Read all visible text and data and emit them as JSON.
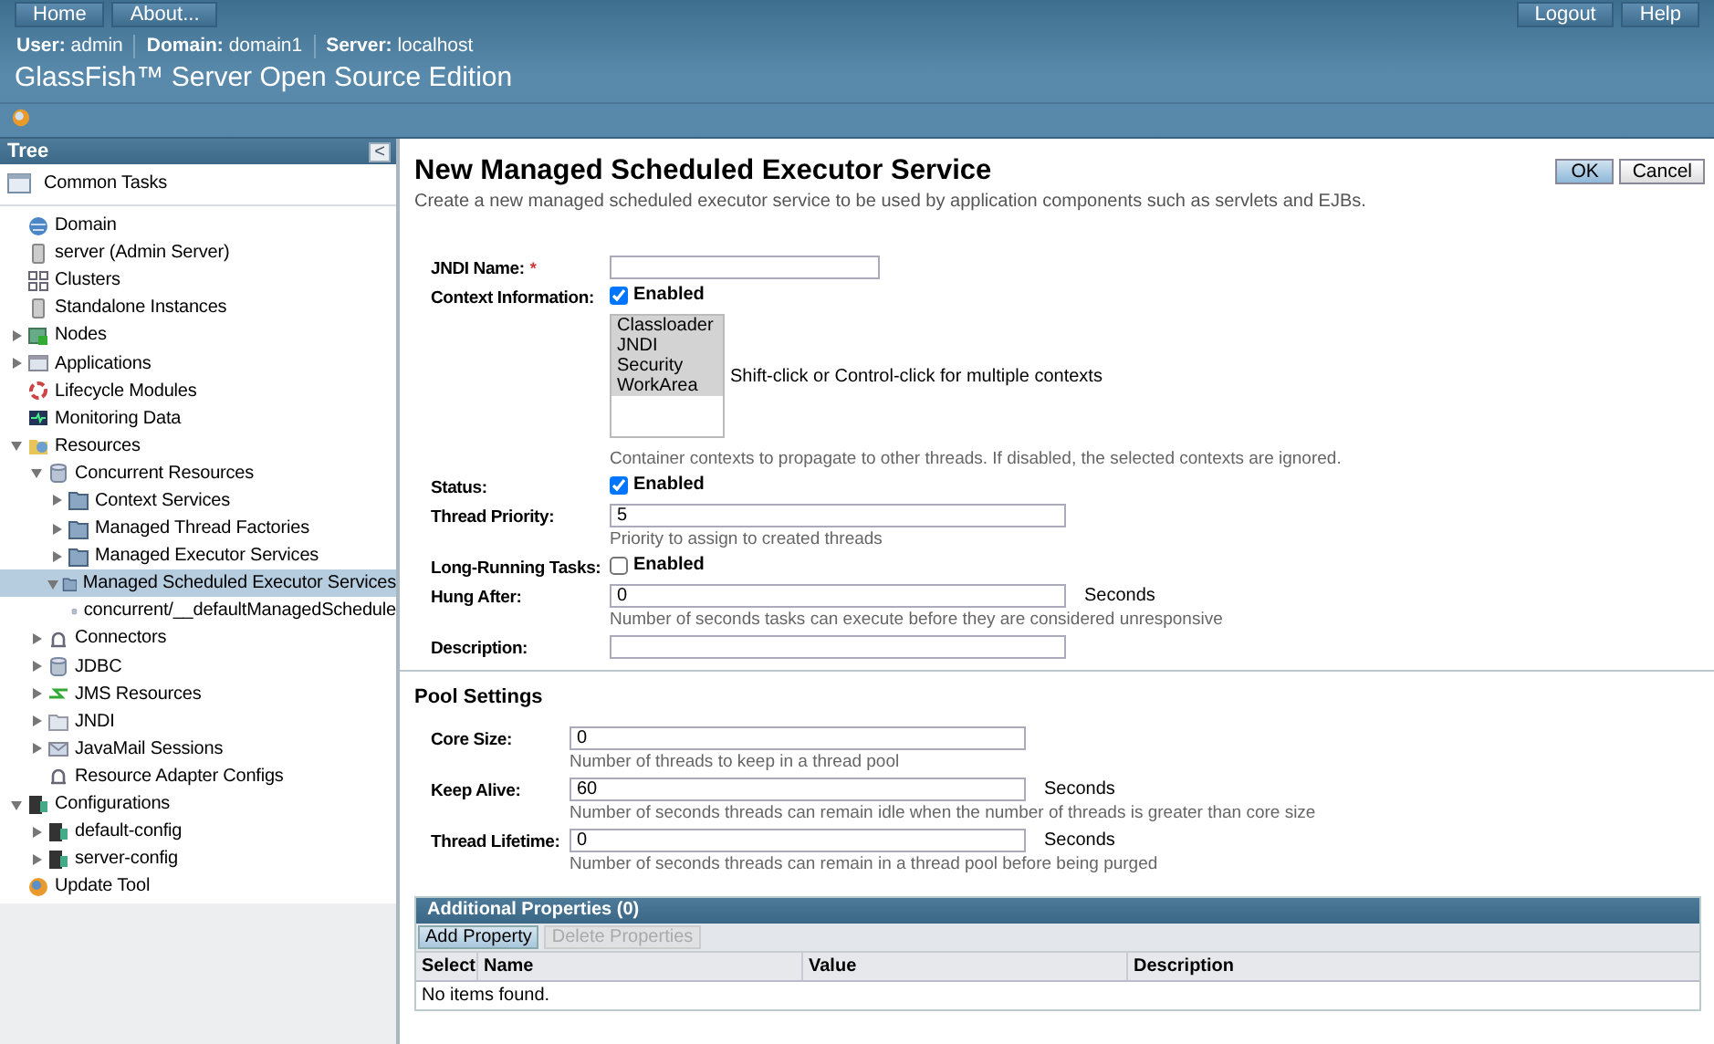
{
  "masthead": {
    "nav": [
      "Home",
      "About..."
    ],
    "session": [
      {
        "label": "User:",
        "value": "admin"
      },
      {
        "label": "Domain:",
        "value": "domain1"
      },
      {
        "label": "Server:",
        "value": "localhost"
      }
    ],
    "actions": [
      "Logout",
      "Help"
    ],
    "product": "GlassFish™ Server Open Source Edition"
  },
  "tree": {
    "title": "Tree",
    "collapse": "<",
    "common_tasks": "Common Tasks",
    "items": [
      {
        "label": "Domain",
        "selected": false
      },
      {
        "label": "server (Admin Server)",
        "selected": false
      },
      {
        "label": "Clusters",
        "selected": false
      },
      {
        "label": "Standalone Instances",
        "selected": false
      },
      {
        "label": "Nodes",
        "selected": false,
        "expanded": false
      },
      {
        "label": "Applications",
        "selected": false,
        "expanded": false
      },
      {
        "label": "Lifecycle Modules",
        "selected": false
      },
      {
        "label": "Monitoring Data",
        "selected": false
      },
      {
        "label": "Resources",
        "selected": false,
        "expanded": true,
        "children": [
          {
            "label": "Concurrent Resources",
            "selected": false,
            "expanded": true,
            "children": [
              {
                "label": "Context Services",
                "selected": false,
                "expanded": false
              },
              {
                "label": "Managed Thread Factories",
                "selected": false,
                "expanded": false
              },
              {
                "label": "Managed Executor Services",
                "selected": false,
                "expanded": false
              },
              {
                "label": "Managed Scheduled Executor Services",
                "selected": true,
                "expanded": true,
                "children": [
                  {
                    "label": "concurrent/__defaultManagedSchedule",
                    "selected": false
                  }
                ]
              }
            ]
          },
          {
            "label": "Connectors",
            "selected": false,
            "expanded": false
          },
          {
            "label": "JDBC",
            "selected": false,
            "expanded": false
          },
          {
            "label": "JMS Resources",
            "selected": false,
            "expanded": false
          },
          {
            "label": "JNDI",
            "selected": false,
            "expanded": false
          },
          {
            "label": "JavaMail Sessions",
            "selected": false,
            "expanded": false
          },
          {
            "label": "Resource Adapter Configs",
            "selected": false
          }
        ]
      },
      {
        "label": "Configurations",
        "selected": false,
        "expanded": true,
        "children": [
          {
            "label": "default-config",
            "selected": false,
            "expanded": false
          },
          {
            "label": "server-config",
            "selected": false,
            "expanded": false
          }
        ]
      },
      {
        "label": "Update Tool",
        "selected": false
      }
    ]
  },
  "page": {
    "title": "New Managed Scheduled Executor Service",
    "description": "Create a new managed scheduled executor service to be used by application components such as servlets and EJBs.",
    "buttons": [
      "OK",
      "Cancel"
    ],
    "rows": [
      {
        "kind": "text-short",
        "label": "JNDI Name:",
        "required_mark": "*"
      },
      {
        "kind": "checkbox",
        "label": "Context Information:",
        "checked": true,
        "option": "Enabled"
      },
      {
        "kind": "listbox",
        "options": [
          {
            "label": "Classloader",
            "selected": true
          },
          {
            "label": "JNDI",
            "selected": true
          },
          {
            "label": "Security",
            "selected": true
          },
          {
            "label": "WorkArea",
            "selected": true
          }
        ],
        "note": "Shift-click or Control-click for multiple contexts",
        "help": "Container contexts to propagate to other threads. If disabled, the selected contexts are ignored."
      },
      {
        "kind": "checkbox",
        "label": "Status:",
        "checked": true,
        "option": "Enabled"
      },
      {
        "kind": "text",
        "label": "Thread Priority:",
        "value": "5",
        "help": "Priority to assign to created threads"
      },
      {
        "kind": "checkbox",
        "label": "Long-Running Tasks:",
        "checked": false,
        "option": "Enabled"
      },
      {
        "kind": "text",
        "label": "Hung After:",
        "value": "0",
        "unit": "Seconds",
        "help": "Number of seconds tasks can execute before they are considered unresponsive"
      },
      {
        "kind": "text",
        "label": "Description:"
      }
    ]
  },
  "pool": {
    "title": "Pool Settings",
    "rows": [
      {
        "kind": "text",
        "label": "Core Size:",
        "value": "0",
        "help": "Number of threads to keep in a thread pool"
      },
      {
        "kind": "text",
        "label": "Keep Alive:",
        "value": "60",
        "unit": "Seconds",
        "help": "Number of seconds threads can remain idle when the number of threads is greater than core size"
      },
      {
        "kind": "text",
        "label": "Thread Lifetime:",
        "value": "0",
        "unit": "Seconds",
        "help": "Number of seconds threads can remain in a thread pool before being purged"
      }
    ]
  },
  "properties": {
    "title": "Additional Properties (0)",
    "buttons": [
      {
        "label": "Add Property",
        "disabled": false
      },
      {
        "label": "Delete Properties",
        "disabled": true
      }
    ],
    "columns": [
      "Select",
      "Name",
      "Value",
      "Description"
    ],
    "empty": "No items found."
  }
}
